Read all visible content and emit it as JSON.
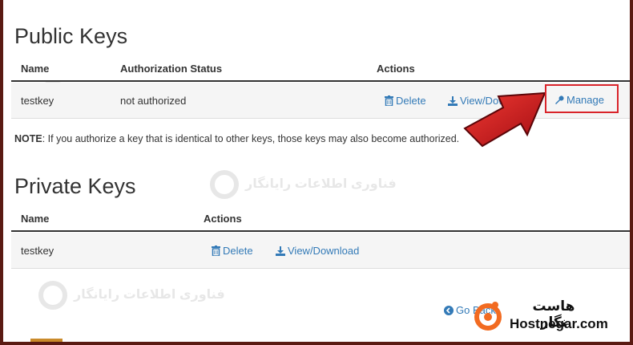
{
  "public_keys": {
    "title": "Public Keys",
    "headers": {
      "name": "Name",
      "status": "Authorization Status",
      "actions": "Actions"
    },
    "rows": [
      {
        "name": "testkey",
        "status": "not authorized",
        "delete": "Delete",
        "view": "View/Download",
        "manage": "Manage"
      }
    ],
    "note_label": "NOTE",
    "note_text": ": If you authorize a key that is identical to other keys, those keys may also become authorized."
  },
  "private_keys": {
    "title": "Private Keys",
    "headers": {
      "name": "Name",
      "actions": "Actions"
    },
    "rows": [
      {
        "name": "testkey",
        "delete": "Delete",
        "view": "View/Download"
      }
    ]
  },
  "go_back": "Go Back",
  "watermark": {
    "fa_title": "هاست نگار",
    "fa_subtitle": "فناوری اطلاعات رایانگار",
    "en": "Hostnegar.com"
  },
  "colors": {
    "link": "#337ab7",
    "highlight": "#d9242a",
    "arrow": "#c8161d"
  },
  "icons": [
    "trash-icon",
    "download-icon",
    "wrench-icon",
    "back-arrow-icon",
    "hostnegar-logo-icon"
  ]
}
